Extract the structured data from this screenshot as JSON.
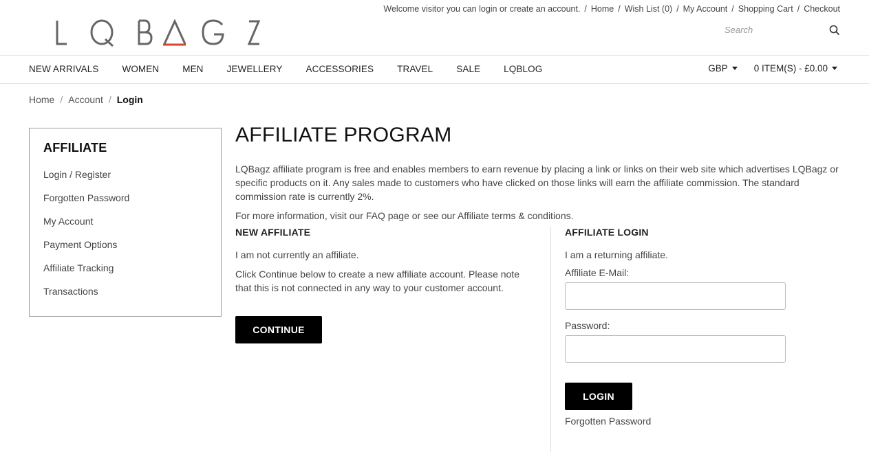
{
  "topbar": {
    "welcome": "Welcome visitor you can login or create an account.",
    "links": [
      "Home",
      "Wish List (0)",
      "My Account",
      "Shopping Cart",
      "Checkout"
    ]
  },
  "logo": {
    "text": "LQBAGZ",
    "accent_color": "#d9442c"
  },
  "search": {
    "placeholder": "Search"
  },
  "nav": {
    "items": [
      "NEW ARRIVALS",
      "WOMEN",
      "MEN",
      "JEWELLERY",
      "ACCESSORIES",
      "TRAVEL",
      "SALE",
      "LQBLOG"
    ],
    "currency": "GBP",
    "cart": "0 ITEM(S) - £0.00"
  },
  "breadcrumb": {
    "items": [
      "Home",
      "Account"
    ],
    "current": "Login"
  },
  "sidebar": {
    "title": "AFFILIATE",
    "items": [
      "Login / Register",
      "Forgotten Password",
      "My Account",
      "Payment Options",
      "Affiliate Tracking",
      "Transactions"
    ]
  },
  "main": {
    "title": "AFFILIATE PROGRAM",
    "intro": "LQBagz affiliate program is free and enables members to earn revenue by placing a link or links on their web site which advertises LQBagz or specific products on it. Any sales made to customers who have clicked on those links will earn the affiliate commission. The standard commission rate is currently 2%.",
    "more": "For more information, visit our FAQ page or see our Affiliate terms & conditions."
  },
  "new_affiliate": {
    "heading": "NEW AFFILIATE",
    "line1": "I am not currently an affiliate.",
    "line2": "Click Continue below to create a new affiliate account. Please note that this is not connected in any way to your customer account.",
    "button": "CONTINUE"
  },
  "affiliate_login": {
    "heading": "AFFILIATE LOGIN",
    "line1": "I am a returning affiliate.",
    "email_label": "Affiliate E-Mail:",
    "password_label": "Password:",
    "button": "LOGIN",
    "forgot": "Forgotten Password"
  }
}
